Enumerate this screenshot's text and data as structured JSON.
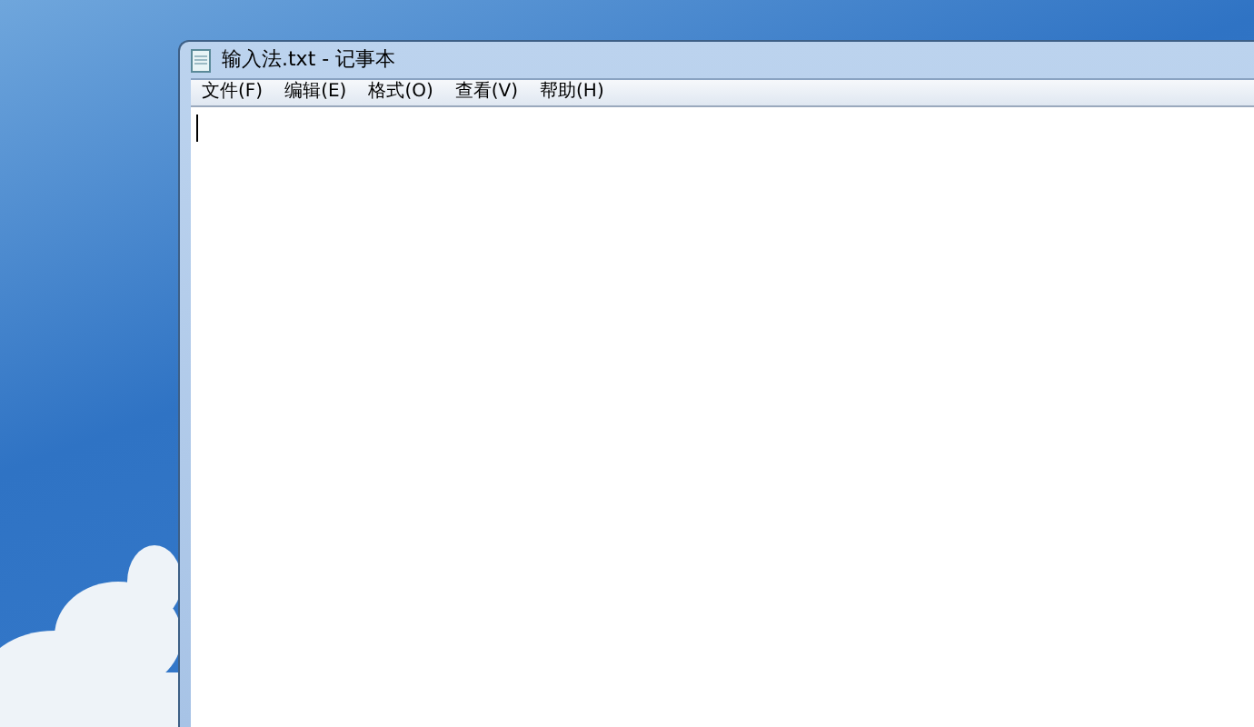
{
  "window": {
    "title": "输入法.txt - 记事本"
  },
  "menu": [
    "文件(F)",
    "编辑(E)",
    "格式(O)",
    "查看(V)",
    "帮助(H)"
  ]
}
